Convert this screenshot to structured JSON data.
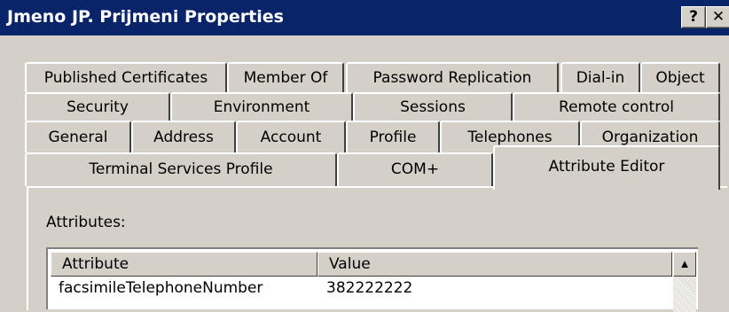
{
  "window": {
    "title": "Jmeno JP. Prijmeni Properties",
    "help_label": "?",
    "close_label": "✕"
  },
  "tabs": {
    "row1": [
      "Published Certificates",
      "Member Of",
      "Password Replication",
      "Dial-in",
      "Object"
    ],
    "row2": [
      "Security",
      "Environment",
      "Sessions",
      "Remote control"
    ],
    "row3": [
      "General",
      "Address",
      "Account",
      "Profile",
      "Telephones",
      "Organization"
    ],
    "row4": [
      "Terminal Services Profile",
      "COM+",
      "Attribute Editor"
    ],
    "active": "Attribute Editor"
  },
  "panel": {
    "attributes_label": "Attributes:",
    "list": {
      "columns": [
        "Attribute",
        "Value"
      ],
      "rows": [
        {
          "attribute": "facsimileTelephoneNumber",
          "value": "382222222"
        }
      ],
      "scroll_up_glyph": "▲"
    }
  },
  "icons": {
    "scroll-up": "up-triangle"
  }
}
